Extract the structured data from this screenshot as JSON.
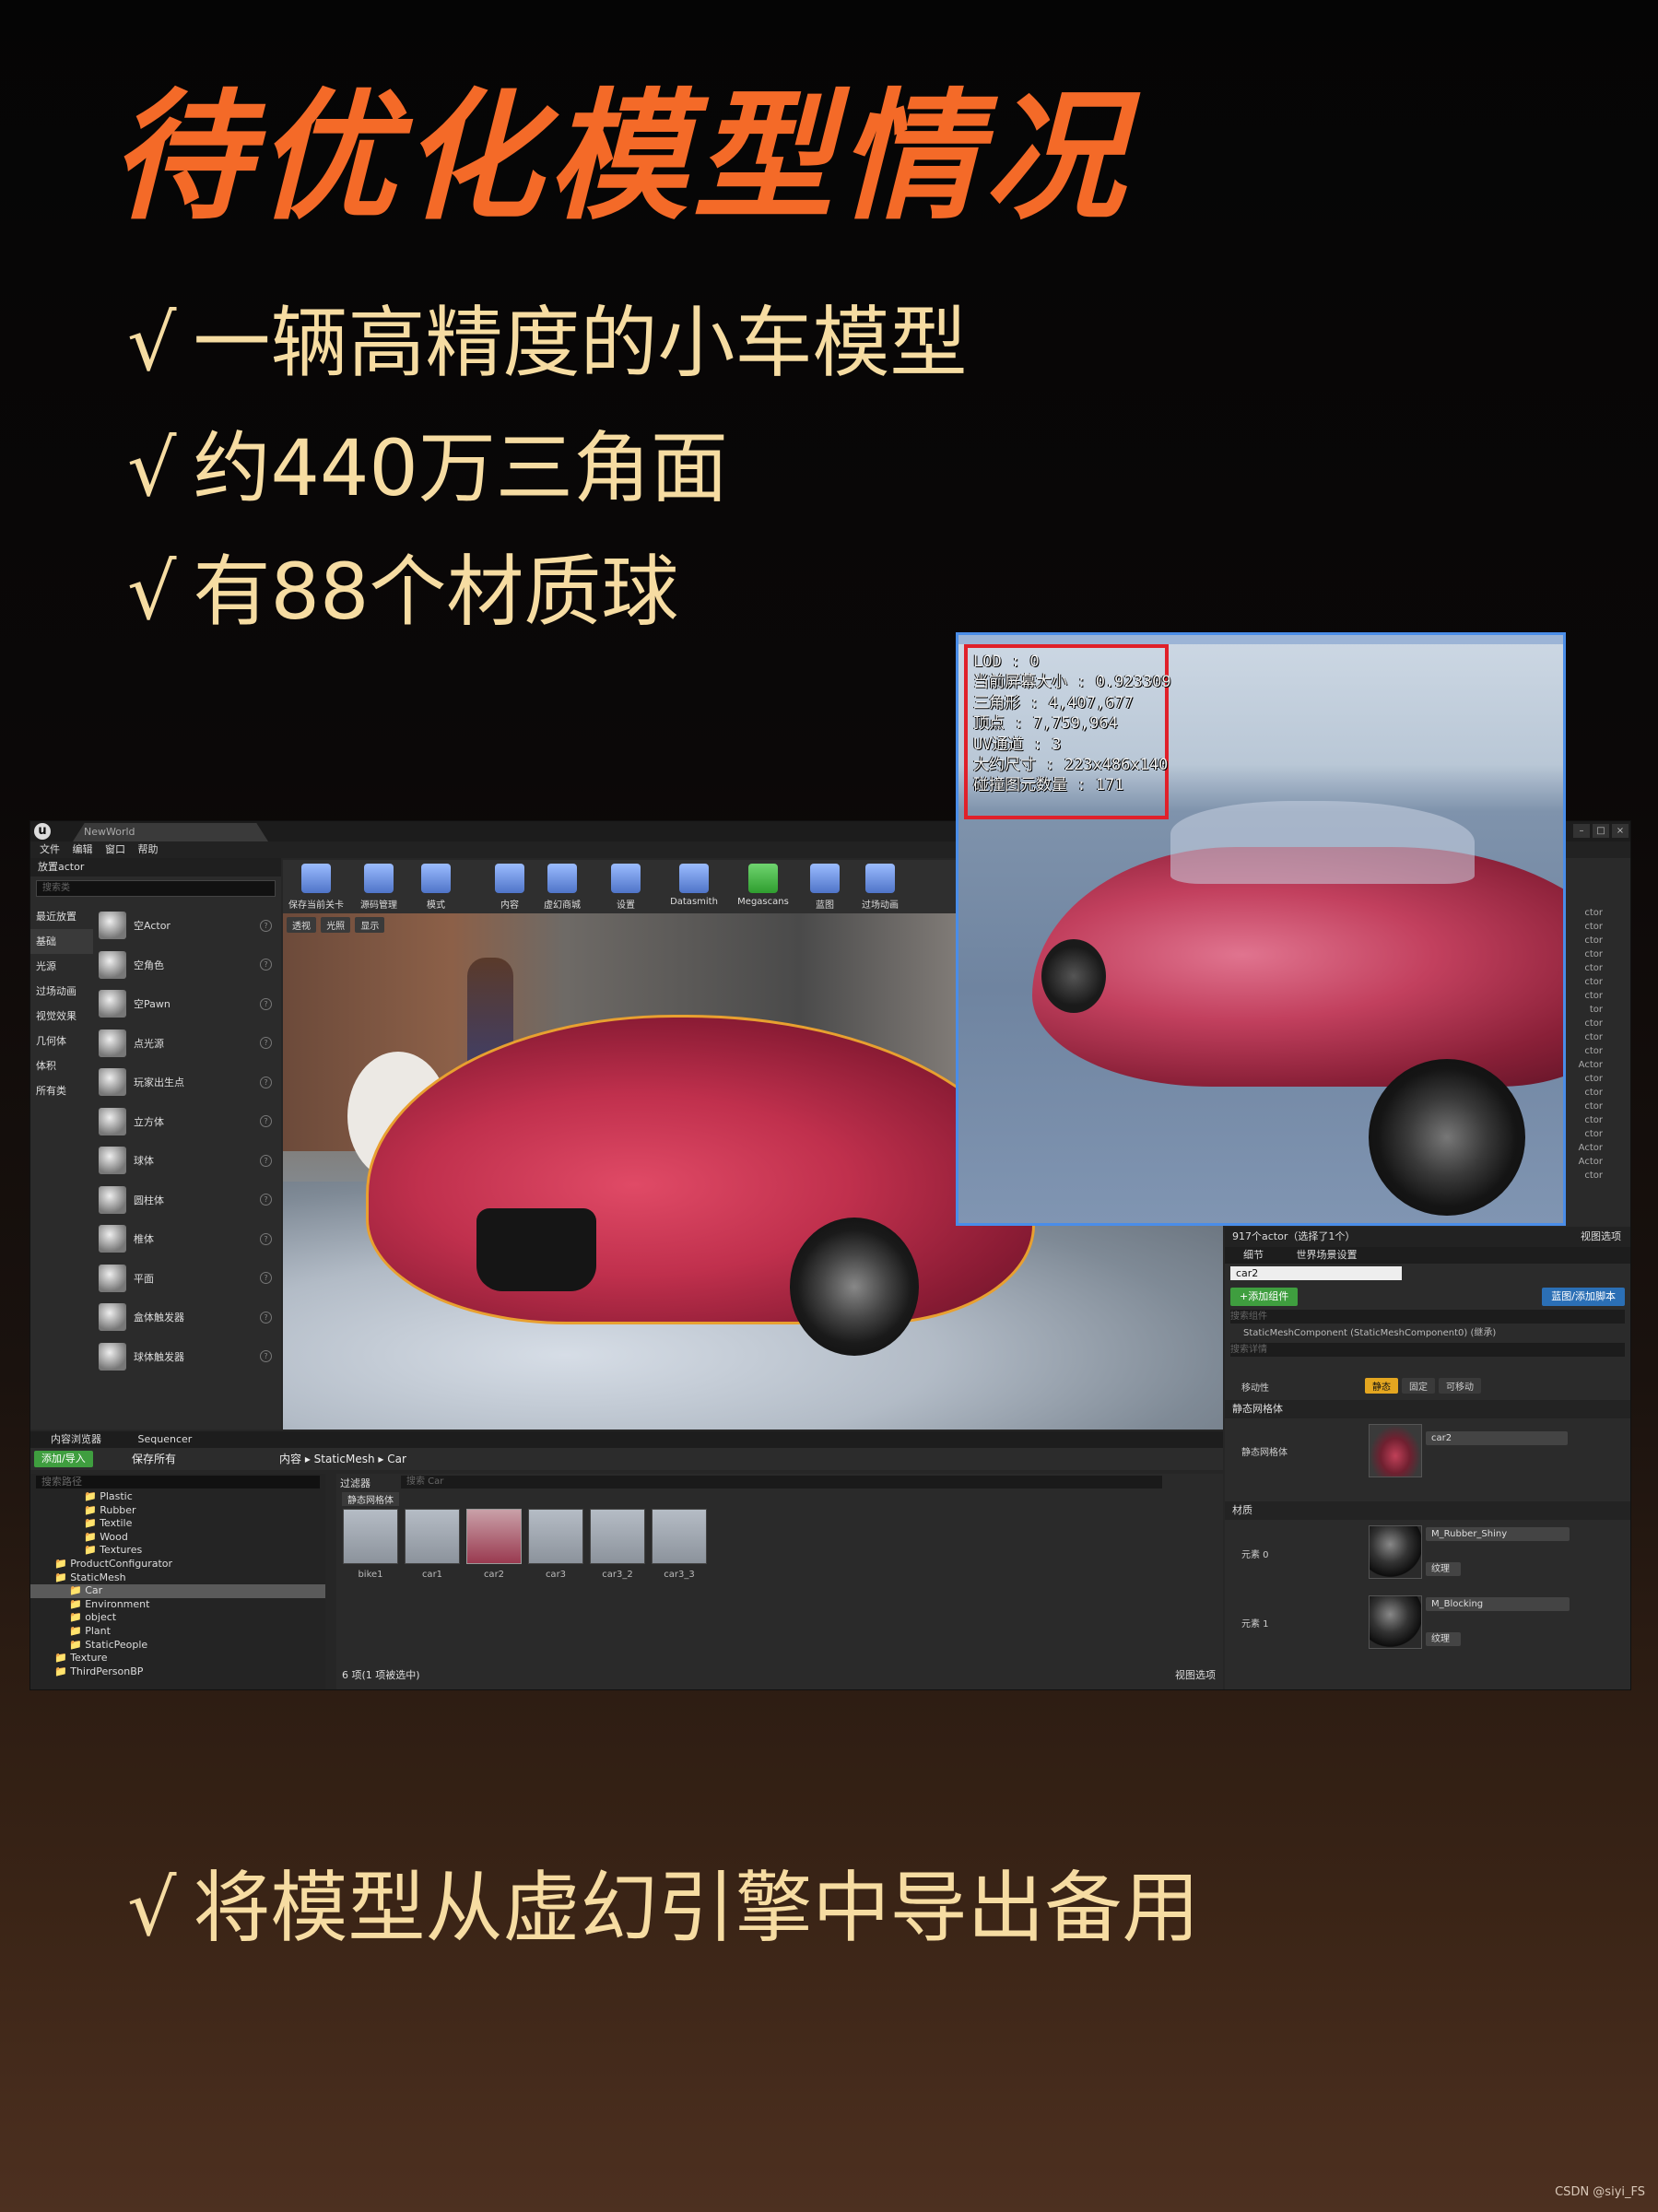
{
  "title": "待优化模型情况",
  "bullets": [
    "一辆高精度的小车模型",
    "约440万三角面",
    "有88个材质球"
  ],
  "bottom_bullet": "将模型从虚幻引擎中导出备用",
  "check": "√",
  "watermark": "CSDN @siyi_FS",
  "ue": {
    "logo": "u",
    "tab_title": "NewWorld",
    "menu": [
      "文件",
      "编辑",
      "窗口",
      "帮助"
    ],
    "place_actor": {
      "tab": "放置actor",
      "search_placeholder": "搜索类",
      "categories": [
        "最近放置",
        "基础",
        "光源",
        "过场动画",
        "视觉效果",
        "几何体",
        "体积",
        "所有类"
      ],
      "items": [
        "空Actor",
        "空角色",
        "空Pawn",
        "点光源",
        "玩家出生点",
        "立方体",
        "球体",
        "圆柱体",
        "椎体",
        "平面",
        "盒体触发器",
        "球体触发器"
      ]
    },
    "toolbar": [
      "保存当前关卡",
      "源码管理",
      "模式",
      "内容",
      "虚幻商城",
      "设置",
      "Datasmith",
      "Megascans",
      "蓝图",
      "过场动画"
    ],
    "viewport_buttons": [
      "透视",
      "光照",
      "显示"
    ],
    "outliner": {
      "rows": [
        "ctor",
        "ctor",
        "ctor",
        "ctor",
        "ctor",
        "ctor",
        "ctor",
        "tor",
        "ctor",
        "ctor",
        "ctor",
        "Actor",
        "ctor",
        "ctor",
        "ctor",
        "ctor",
        "ctor",
        "Actor",
        "Actor",
        "ctor"
      ],
      "status": "917个actor（选择了1个）",
      "view_options": "视图选项"
    },
    "details": {
      "tabs": [
        "细节",
        "世界场景设置"
      ],
      "name": "car2",
      "add_component": "+添加组件",
      "blueprint": "蓝图/添加脚本",
      "search_components": "搜索组件",
      "component": "StaticMeshComponent (StaticMeshComponent0) (继承)",
      "search_details": "搜索详情",
      "mobility_label": "移动性",
      "mobility_options": [
        "静态",
        "固定",
        "可移动"
      ],
      "mesh_section": "静态网格体",
      "mesh_label": "静态网格体",
      "mesh_value": "car2",
      "material_section": "材质",
      "elements": [
        {
          "label": "元素 0",
          "material": "M_Rubber_Shiny",
          "tag": "纹理"
        },
        {
          "label": "元素 1",
          "material": "M_Blocking",
          "tag": "纹理"
        }
      ]
    },
    "content_browser": {
      "tabs": [
        "内容浏览器",
        "Sequencer"
      ],
      "import_button": "添加/导入",
      "save_all": "保存所有",
      "breadcrumb": [
        "内容",
        "StaticMesh",
        "Car"
      ],
      "search_paths": "搜索路径",
      "filters": "过滤器",
      "search_car": "搜索 Car",
      "filter_tag": "静态网格体",
      "tree": [
        {
          "label": "Plastic",
          "indent": 3
        },
        {
          "label": "Rubber",
          "indent": 3
        },
        {
          "label": "Textile",
          "indent": 3
        },
        {
          "label": "Wood",
          "indent": 3
        },
        {
          "label": "Textures",
          "indent": 3
        },
        {
          "label": "ProductConfigurator",
          "indent": 1
        },
        {
          "label": "StaticMesh",
          "indent": 1
        },
        {
          "label": "Car",
          "indent": 2,
          "selected": true
        },
        {
          "label": "Environment",
          "indent": 2
        },
        {
          "label": "object",
          "indent": 2
        },
        {
          "label": "Plant",
          "indent": 2
        },
        {
          "label": "StaticPeople",
          "indent": 2
        },
        {
          "label": "Texture",
          "indent": 1
        },
        {
          "label": "ThirdPersonBP",
          "indent": 1
        }
      ],
      "assets": [
        "bike1",
        "car1",
        "car2",
        "car3",
        "car3_2",
        "car3_3"
      ],
      "selected_asset": "car2",
      "status": "6 项(1 项被选中)",
      "view_options": "视图选项"
    }
  },
  "preview_stats": [
    "LOD : 0",
    "当前屏幕大小 : 0.923309",
    "三角形 : 4,407,677",
    "顶点 : 7,759,964",
    "UV通道 : 3",
    "大约尺寸 : 223x486x140",
    "碰撞图元数量 : 171"
  ],
  "colors": {
    "title": "#f46a28",
    "bullet": "#f6dca2",
    "stats_border": "#e0202a",
    "preview_border": "#4a8de8"
  }
}
